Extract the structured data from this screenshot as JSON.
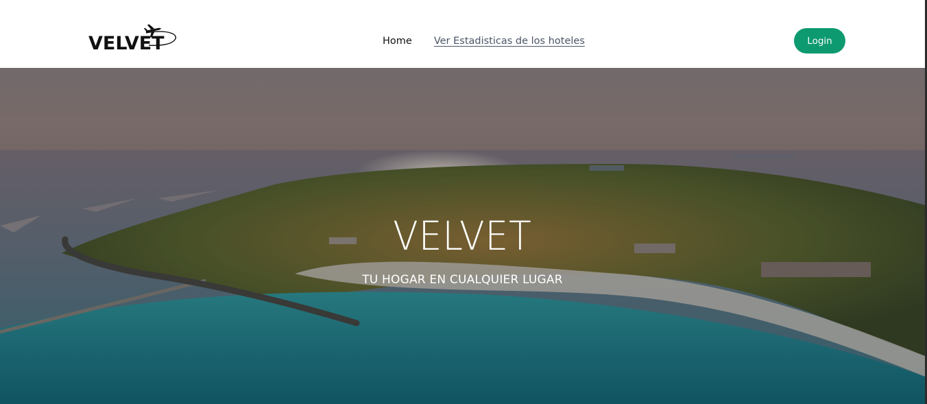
{
  "header": {
    "logo_text": "VELVET",
    "nav": [
      {
        "label": "Home"
      },
      {
        "label": "Ver Estadisticas de los hoteles"
      }
    ],
    "login_label": "Login"
  },
  "hero": {
    "title": "VELVET",
    "subtitle": "TU HOGAR EN CUALQUIER LUGAR"
  },
  "colors": {
    "accent": "#0e9a70",
    "header_bg": "#ffffff",
    "nav_link": "#4a5568"
  },
  "icons": {
    "logo_icon": "airplane-icon"
  }
}
